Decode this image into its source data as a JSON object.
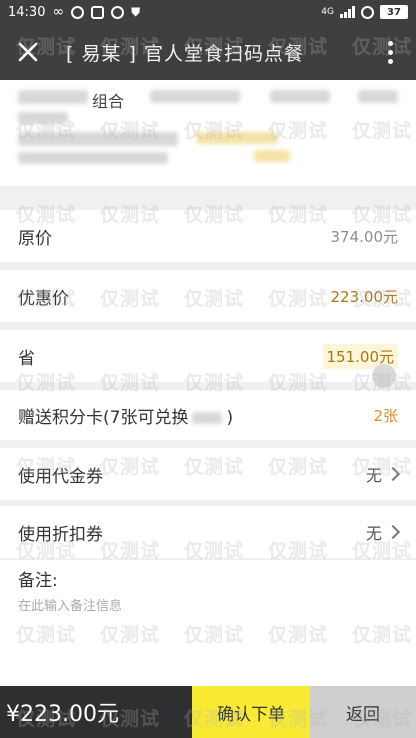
{
  "status_bar": {
    "time": "14:30",
    "network": "4G",
    "battery": "37"
  },
  "header": {
    "title": "[ 易某 ] 官人堂食扫码点餐"
  },
  "product": {
    "name": "组合"
  },
  "rows": [
    {
      "id": "original-price",
      "label": "原价",
      "value": "374.00元"
    },
    {
      "id": "discount-price",
      "label": "优惠价",
      "value": "223.00元"
    },
    {
      "id": "saved",
      "label": "省",
      "value": "151.00元"
    },
    {
      "id": "points-card",
      "label": "赠送积分卡(7张可兑换",
      "label_end": ")",
      "value": "2张"
    },
    {
      "id": "voucher",
      "label": "使用代金券",
      "value": "无"
    },
    {
      "id": "coupon",
      "label": "使用折扣券",
      "value": "无"
    }
  ],
  "notes": {
    "label": "备注:",
    "placeholder": "在此输入备注信息"
  },
  "bottom": {
    "total": "¥223.00元",
    "confirm": "确认下单",
    "back": "返回"
  },
  "watermark": {
    "text": "仅测试"
  },
  "colors": {
    "dark_bar": "#3d3f41",
    "confirm_yellow": "#f8ea33",
    "gold_text": "#a87715"
  }
}
